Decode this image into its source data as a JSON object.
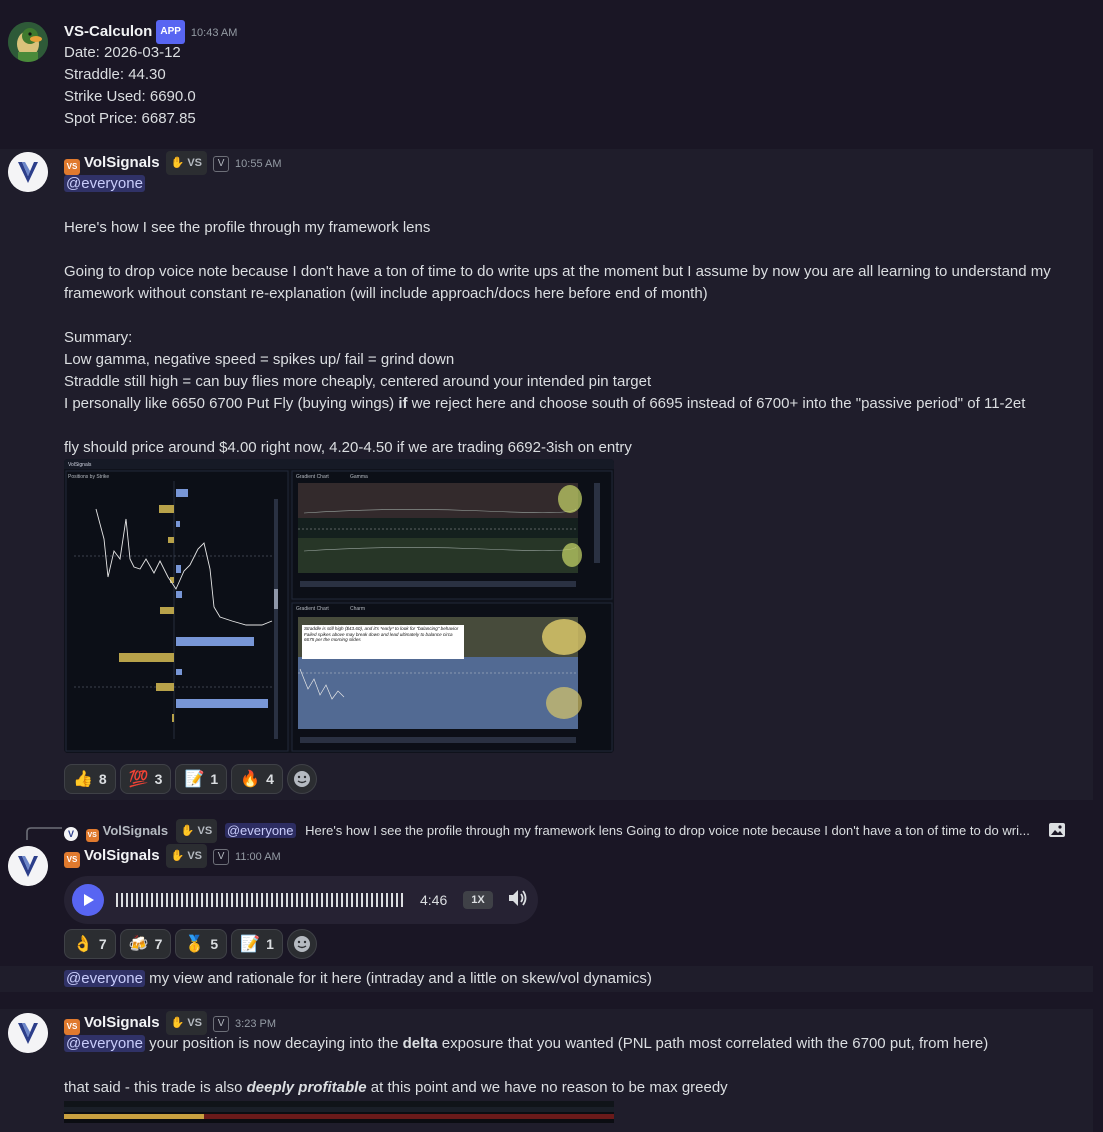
{
  "messages": [
    {
      "author": "VS-Calculon",
      "badge": "APP",
      "time": "10:43 AM",
      "lines": [
        "Date: 2026-03-12",
        "Straddle: 44.30",
        "Strike Used: 6690.0",
        "Spot Price: 6687.85"
      ]
    },
    {
      "author": "VolSignals",
      "tag_icon": "VS",
      "guild_tag": "VS",
      "v_badge": "V",
      "time": "10:55 AM",
      "mention": "@everyone",
      "para1": "Here's how I see the profile through my framework lens",
      "para2a": "Going to drop voice note because I don't have a ton of time to do write ups at the moment but I assume by now you are all learning to understand my",
      "para2b": "framework without constant re-explanation (will include approach/docs here before end of month)",
      "summary_title": "Summary:",
      "summary1": "Low gamma, negative speed = spikes up/ fail = grind down",
      "summary2": "Straddle still high = can buy flies more cheaply, centered around your intended pin target",
      "summary3_pre": "I personally like 6650 6700 Put Fly (buying wings) ",
      "summary3_bold": "if",
      "summary3_post": " we reject here and choose south of 6695 instead of 6700+ into the \"passive period\" of 11-2et",
      "fly_line": "fly should price around $4.00 right now, 4.20-4.50 if we are trading 6692-3ish on entry",
      "screenshot": {
        "app_name": "VolSignals",
        "panel1_title": "Positions by Strike",
        "panel2_title": "Gradient Chart",
        "panel2_metric": "Gamma",
        "panel3_title": "Gradient Chart",
        "panel3_metric": "Charm",
        "note": "Straddle is still high ($43.60), and it's *early* to look for \"balancing\" behavior Failed spikes above may break down and lead ultimately to balance circa 6675 per the morning slides"
      },
      "reactions": [
        {
          "emoji": "👍",
          "count": "8"
        },
        {
          "emoji": "💯",
          "count": "3"
        },
        {
          "emoji": "📝",
          "count": "1"
        },
        {
          "emoji": "🔥",
          "count": "4"
        }
      ]
    },
    {
      "reply_author": "VolSignals",
      "reply_guild_tag": "VS",
      "reply_mention": "@everyone",
      "reply_text": "Here's how I see the profile through my framework lens  Going to drop voice note because I don't have a ton of time to do wri...",
      "author": "VolSignals",
      "guild_tag": "VS",
      "v_badge": "V",
      "time": "11:00 AM",
      "voice": {
        "duration": "4:46",
        "speed": "1X"
      },
      "reactions": [
        {
          "emoji": "👌",
          "count": "7"
        },
        {
          "emoji": "🍻",
          "count": "7"
        },
        {
          "emoji": "🥇",
          "count": "5"
        },
        {
          "emoji": "📝",
          "count": "1"
        }
      ]
    },
    {
      "mention": "@everyone",
      "text": " my view and rationale for it here (intraday and a little on skew/vol dynamics)"
    },
    {
      "author": "VolSignals",
      "guild_tag": "VS",
      "v_badge": "V",
      "time": "3:23 PM",
      "mention": "@everyone",
      "line1_pre": " your position is now decaying into the ",
      "line1_bold": "delta",
      "line1_post": " exposure that you wanted (PNL path most correlated with the 6700 put, from here)",
      "line2_pre": "that said - this trade is also ",
      "line2_bi": "deeply profitable",
      "line2_post": " at this point and we have no reason to be max greedy"
    }
  ],
  "colors": {
    "background": "#1a1625",
    "mention_bg": "#3c3f7a",
    "accent": "#5865f2",
    "highlight": "#1f1d2b"
  }
}
